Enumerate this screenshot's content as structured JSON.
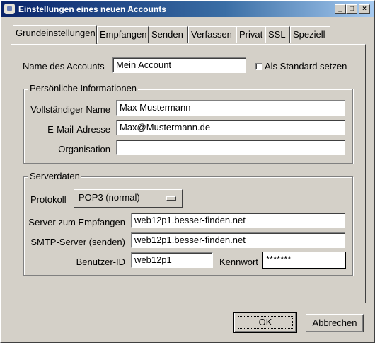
{
  "window": {
    "title": "Einstellungen eines neuen Accounts",
    "controls": {
      "minimize": "_",
      "maximize": "□",
      "close": "×"
    }
  },
  "tabs": [
    {
      "label": "Grundeinstellungen",
      "active": true
    },
    {
      "label": "Empfangen"
    },
    {
      "label": "Senden"
    },
    {
      "label": "Verfassen"
    },
    {
      "label": "Privat"
    },
    {
      "label": "SSL"
    },
    {
      "label": "Speziell"
    }
  ],
  "account": {
    "name_label": "Name des Accounts",
    "name_value": "Mein Account",
    "default_checkbox_label": "Als Standard setzen",
    "default_checked": false
  },
  "personal": {
    "group_title": "Persönliche Informationen",
    "fullname_label": "Vollständiger Name",
    "fullname_value": "Max Mustermann",
    "email_label": "E-Mail-Adresse",
    "email_value": "Max@Mustermann.de",
    "org_label": "Organisation",
    "org_value": ""
  },
  "server": {
    "group_title": "Serverdaten",
    "protocol_label": "Protokoll",
    "protocol_value": "POP3 (normal)",
    "incoming_label": "Server zum Empfangen",
    "incoming_value": "web12p1.besser-finden.net",
    "smtp_label": "SMTP-Server (senden)",
    "smtp_value": "web12p1.besser-finden.net",
    "userid_label": "Benutzer-ID",
    "userid_value": "web12p1",
    "password_label": "Kennwort",
    "password_value": "*******"
  },
  "buttons": {
    "ok": "OK",
    "cancel": "Abbrechen"
  }
}
